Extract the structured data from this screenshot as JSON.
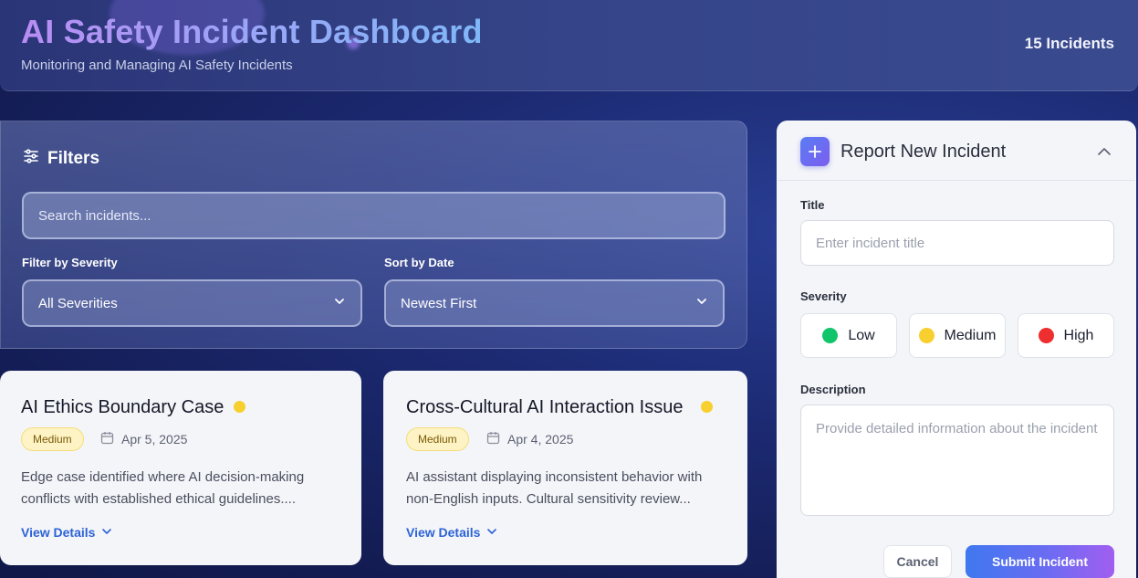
{
  "header": {
    "title": "AI Safety Incident Dashboard",
    "subtitle": "Monitoring and Managing AI Safety Incidents",
    "count": "15 Incidents"
  },
  "filters": {
    "title": "Filters",
    "icon": "sliders-icon",
    "search_placeholder": "Search incidents...",
    "severity_label": "Filter by Severity",
    "severity_value": "All Severities",
    "sort_label": "Sort by Date",
    "sort_value": "Newest First"
  },
  "incidents": [
    {
      "title": "AI Ethics Boundary Case",
      "severity": "Medium",
      "severity_color": "#f7cf2e",
      "date": "Apr 5, 2025",
      "description": "Edge case identified where AI decision-making conflicts with established ethical guidelines....",
      "link": "View Details"
    },
    {
      "title": "Cross-Cultural AI Interaction Issue",
      "severity": "Medium",
      "severity_color": "#f7cf2e",
      "date": "Apr 4, 2025",
      "description": "AI assistant displaying inconsistent behavior with non-English inputs. Cultural sensitivity review...",
      "link": "View Details"
    }
  ],
  "report": {
    "title": "Report New Incident",
    "title_label": "Title",
    "title_placeholder": "Enter incident title",
    "severity_label": "Severity",
    "severity_options": [
      {
        "label": "Low",
        "color": "#12c46a"
      },
      {
        "label": "Medium",
        "color": "#f7cf2e"
      },
      {
        "label": "High",
        "color": "#ee2f2f"
      }
    ],
    "description_label": "Description",
    "description_placeholder": "Provide detailed information about the incident",
    "cancel_label": "Cancel",
    "submit_label": "Submit Incident"
  }
}
